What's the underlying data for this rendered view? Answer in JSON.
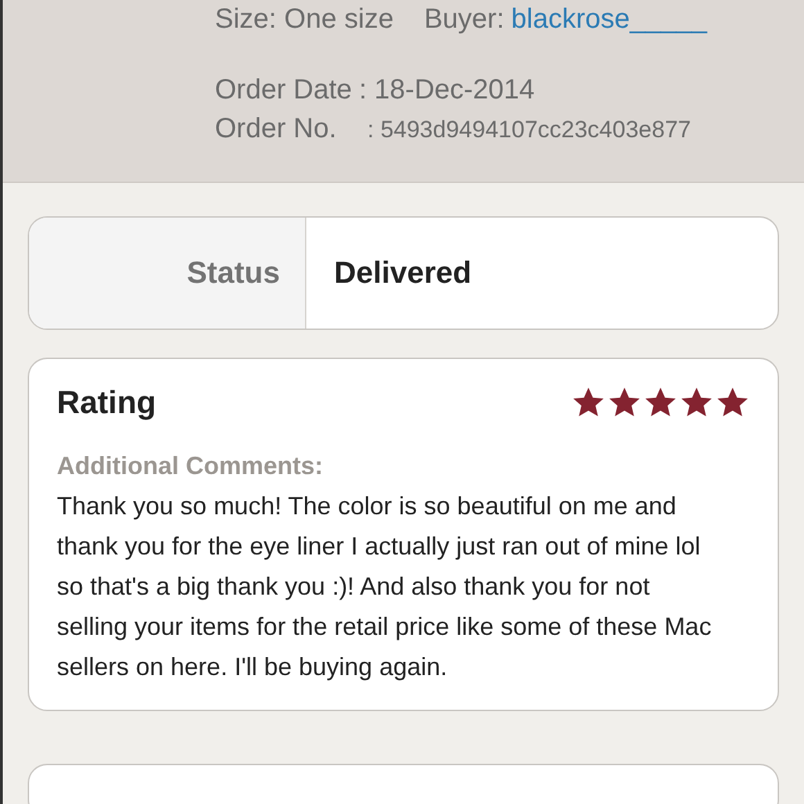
{
  "order": {
    "size_label": "Size: One size",
    "buyer_label": "Buyer:",
    "buyer": "blackrose_____",
    "date_label": "Order Date",
    "date": ": 18-Dec-2014",
    "number_label": "Order No.",
    "number": ": 5493d9494107cc23c403e877"
  },
  "status": {
    "label": "Status",
    "value": "Delivered"
  },
  "rating": {
    "title": "Rating",
    "stars": 5,
    "comments_label": "Additional Comments:",
    "comments": "Thank you so much! The color is so beautiful on me and thank you for the eye liner I actually just ran out of mine lol so that's a big thank you :)! And also thank you for not selling your items for the retail price like some of these Mac sellers on here. I'll be buying again."
  }
}
